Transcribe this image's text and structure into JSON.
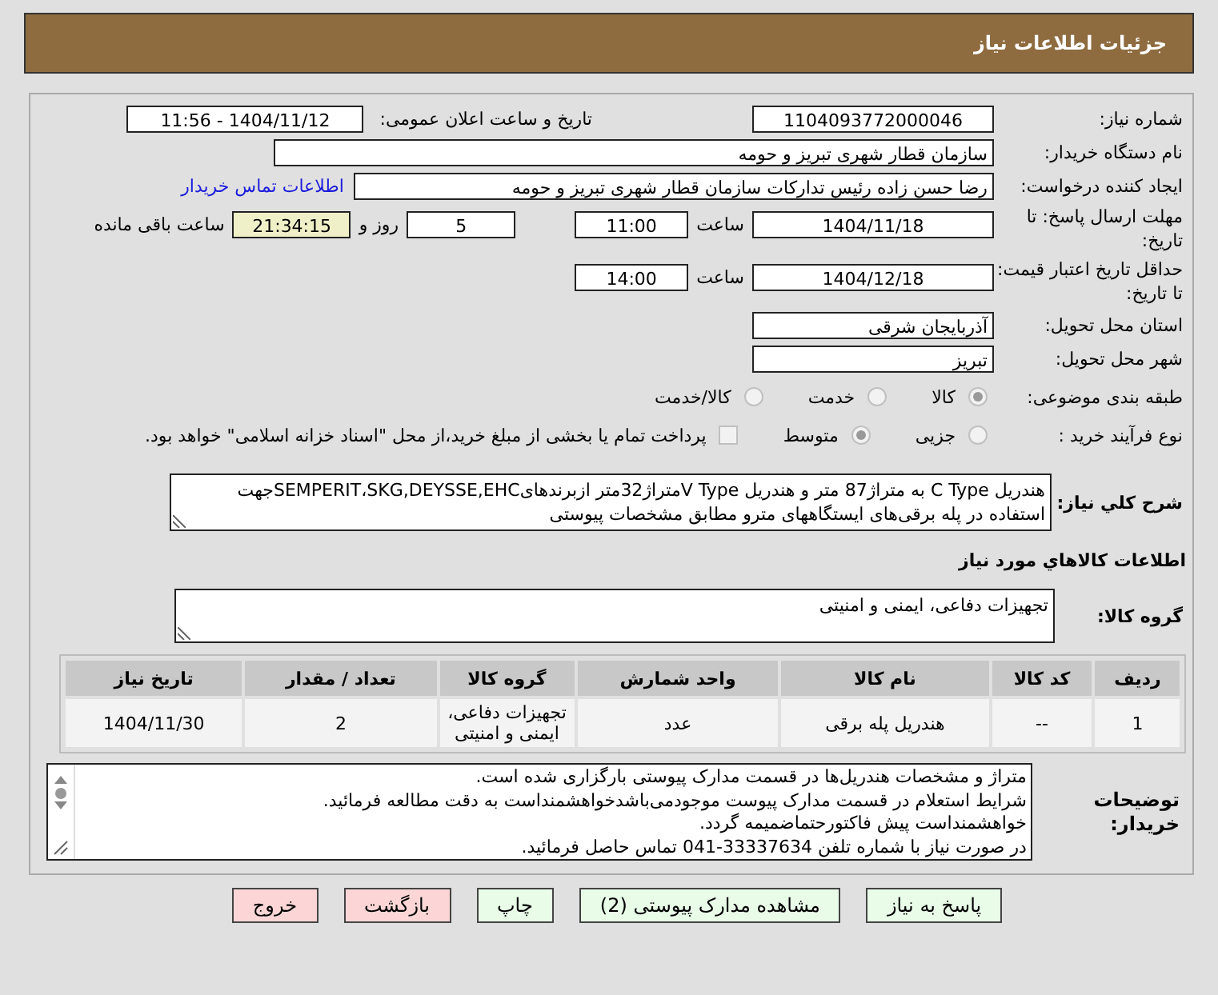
{
  "header": {
    "title": "جزئیات اطلاعات نیاز"
  },
  "need_number": {
    "label": "شماره نیاز:",
    "value": "1104093772000046"
  },
  "announce": {
    "label": "تاریخ و ساعت اعلان عمومی:",
    "value": "1404/11/12 - 11:56"
  },
  "buyer": {
    "label": "نام دستگاه خریدار:",
    "value": "سازمان قطار شهری تبریز و حومه"
  },
  "requester": {
    "label": "ایجاد کننده درخواست:",
    "value": "رضا حسن زاده رئیس تدارکات سازمان قطار شهری تبریز و حومه",
    "link": "اطلاعات تماس خریدار"
  },
  "reply_deadline": {
    "label": "مهلت ارسال پاسخ: تا تاریخ:",
    "date": "1404/11/18",
    "time_label": "ساعت",
    "time": "11:00",
    "days": "5",
    "days_label": "روز و",
    "remaining": "21:34:15",
    "remaining_label": "ساعت باقی مانده"
  },
  "price_validity": {
    "label": "حداقل تاریخ اعتبار قیمت: تا تاریخ:",
    "date": "1404/12/18",
    "time_label": "ساعت",
    "time": "14:00"
  },
  "province": {
    "label": "استان محل تحویل:",
    "value": "آذربایجان شرقی"
  },
  "city": {
    "label": "شهر محل تحویل:",
    "value": "تبریز"
  },
  "category": {
    "label": "طبقه بندی موضوعی:",
    "options": [
      {
        "label": "کالا",
        "selected": true
      },
      {
        "label": "خدمت",
        "selected": false
      },
      {
        "label": "کالا/خدمت",
        "selected": false
      }
    ]
  },
  "process": {
    "label": "نوع فرآیند خرید :",
    "options": [
      {
        "label": "جزیی",
        "selected": false
      },
      {
        "label": "متوسط",
        "selected": true
      }
    ],
    "payment": {
      "label": "پرداخت تمام یا بخشی از مبلغ خرید،از محل \"اسناد خزانه اسلامی\" خواهد بود.",
      "checked": false
    }
  },
  "description": {
    "label": "شرح کلي نياز:",
    "value": "هندریل C Type به متراژ87 متر و هندریل V Typeمتراژ32متر ازبرندهایSEMPERIT،SKG,DEYSSE,EHCجهت استفاده در پله برقی‌های ایستگاههای مترو مطابق مشخصات پیوستی"
  },
  "goods_title": "اطلاعات کالاهاي مورد نياز",
  "goods_group": {
    "label": "گروه کالا:",
    "value": "تجهیزات دفاعی، ایمنی و امنیتی"
  },
  "table": {
    "columns": [
      "ردیف",
      "کد کالا",
      "نام کالا",
      "واحد شمارش",
      "گروه کالا",
      "تعداد / مقدار",
      "تاریخ نیاز"
    ],
    "rows": [
      [
        "1",
        "--",
        "هندریل پله برقی",
        "عدد",
        "تجهیزات دفاعی، ایمنی و امنیتی",
        "2",
        "1404/11/30"
      ]
    ]
  },
  "buyer_notes": {
    "label": "توضیحات خریدار:",
    "lines": [
      "متراژ و مشخصات هندریل‌ها در قسمت مدارک پیوستی بارگزاری شده است.",
      "شرایط استعلام در قسمت مدارک پیوست موجودمی‌باشدخواهشمنداست به دقت مطالعه فرمائید.",
      "خواهشمنداست پیش فاکتورحتماضمیمه گردد.",
      "در صورت نیاز با شماره تلفن 33337634-041 تماس حاصل فرمائید."
    ]
  },
  "buttons": [
    {
      "label": "پاسخ به نیاز",
      "kind": "action"
    },
    {
      "label": "مشاهده مدارک پیوستی (2)",
      "kind": "action"
    },
    {
      "label": "چاپ",
      "kind": "action"
    },
    {
      "label": "بازگشت",
      "kind": "exit"
    },
    {
      "label": "خروج",
      "kind": "exit"
    }
  ]
}
